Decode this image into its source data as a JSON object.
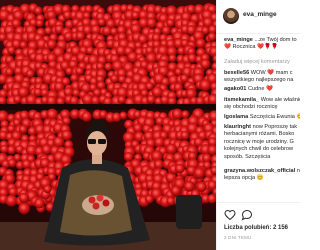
{
  "post": {
    "image": {
      "description_icon": "photo"
    }
  },
  "author": {
    "avatar_icon": "avatar",
    "username": "eva_minge"
  },
  "comments": [
    {
      "user": "eva_minge",
      "lines": [
        "...ze Twój dom to",
        "❤️ Rocznica ❤️🌹🌹"
      ]
    },
    {
      "user": "",
      "lines": [
        "Załaduj więcej komentarzy"
      ]
    },
    {
      "user": "bexelle56",
      "lines": [
        "WOW ❤️ mam c",
        "wszystkiego najlepszego na"
      ]
    },
    {
      "user": "agako01",
      "lines": [
        "Cudne ❤️"
      ]
    },
    {
      "user": "itsmekamila_",
      "lines": [
        "Wow ale właśnie",
        "się obchodzi rocznicę"
      ]
    },
    {
      "user": "lgoslama",
      "lines": [
        "Szczęścia Ewunia 😊"
      ]
    },
    {
      "user": "klauringht",
      "lines": [
        "now Poproszę tak",
        "herbacianymi różami. Bosko",
        "rocznicę w moje urodziny. G",
        "kolejnych chwil do celebrow",
        "sposób. Szczęścia"
      ]
    },
    {
      "user": "grazyna.wolszczak_official",
      "lines": [
        "narozrabiał, tylko rocznica 😊",
        "lepsza opcja 😊"
      ]
    }
  ],
  "actions": {
    "like_icon": "heart-icon",
    "comment_icon": "comment-icon"
  },
  "likes_text": "Liczba polubień: 2 156",
  "date_text": "2 DNI TEMU"
}
